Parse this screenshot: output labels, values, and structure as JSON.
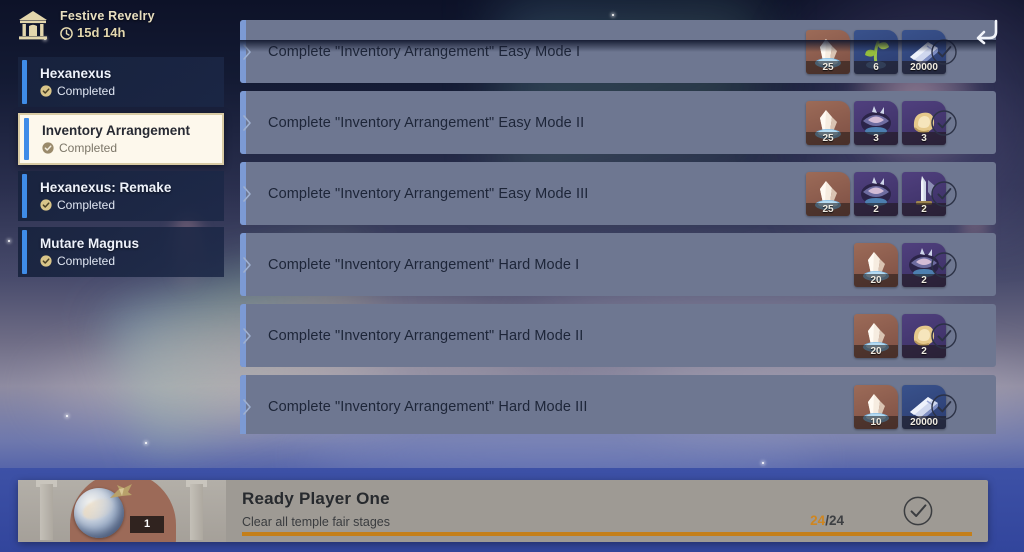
{
  "header": {
    "event_title": "Festive Revelry",
    "timer": "15d 14h",
    "temple_icon": "temple-icon",
    "clock_icon": "clock-icon",
    "back_icon": "back-arrow-icon"
  },
  "sidebar": {
    "items": [
      {
        "title": "Hexanexus",
        "status": "Completed",
        "selected": false
      },
      {
        "title": "Inventory Arrangement",
        "status": "Completed",
        "selected": true
      },
      {
        "title": "Hexanexus: Remake",
        "status": "Completed",
        "selected": false
      },
      {
        "title": "Mutare Magnus",
        "status": "Completed",
        "selected": false
      }
    ]
  },
  "tasks": [
    {
      "label": "Complete \"Inventory Arrangement\" Easy Mode I",
      "rewards": [
        {
          "count": "25",
          "tone": "rv-orange",
          "art": "crystal"
        },
        {
          "count": "6",
          "tone": "rv-blue",
          "art": "sprout"
        },
        {
          "count": "20000",
          "tone": "rv-blue",
          "art": "scroll"
        }
      ],
      "claimed": true
    },
    {
      "label": "Complete \"Inventory Arrangement\" Easy Mode II",
      "rewards": [
        {
          "count": "25",
          "tone": "rv-orange",
          "art": "crystal"
        },
        {
          "count": "3",
          "tone": "rv-purple",
          "art": "gem"
        },
        {
          "count": "3",
          "tone": "rv-purple",
          "art": "cloth"
        }
      ],
      "claimed": true
    },
    {
      "label": "Complete \"Inventory Arrangement\" Easy Mode III",
      "rewards": [
        {
          "count": "25",
          "tone": "rv-orange",
          "art": "crystal"
        },
        {
          "count": "2",
          "tone": "rv-purple",
          "art": "gem"
        },
        {
          "count": "2",
          "tone": "rv-purple",
          "art": "weapon"
        }
      ],
      "claimed": true
    },
    {
      "label": "Complete \"Inventory Arrangement\" Hard Mode I",
      "rewards": [
        {
          "count": "20",
          "tone": "rv-orange",
          "art": "crystal"
        },
        {
          "count": "2",
          "tone": "rv-purple",
          "art": "gem"
        }
      ],
      "claimed": true
    },
    {
      "label": "Complete \"Inventory Arrangement\" Hard Mode II",
      "rewards": [
        {
          "count": "20",
          "tone": "rv-orange",
          "art": "crystal"
        },
        {
          "count": "2",
          "tone": "rv-purple",
          "art": "cloth"
        }
      ],
      "claimed": true
    },
    {
      "label": "Complete \"Inventory Arrangement\" Hard Mode III",
      "rewards": [
        {
          "count": "10",
          "tone": "rv-orange",
          "art": "crystal"
        },
        {
          "count": "20000",
          "tone": "rv-blue",
          "art": "scroll"
        }
      ],
      "claimed": true
    }
  ],
  "bottom_banner": {
    "title": "Ready Player One",
    "subtitle": "Clear all temple fair stages",
    "reward_count": "1",
    "progress_current": "24",
    "progress_separator": "/",
    "progress_total": "24",
    "progress_percent": 100,
    "check_icon": "check-circle-icon"
  },
  "colors": {
    "accent_blue": "#3f8ce8",
    "row_background": "#6e7791",
    "selected_card": "#fdf8ec",
    "selected_border": "#d9cba4",
    "progress_orange": "#c47f1a",
    "band_blue": "#32459c",
    "header_gold": "#e8dfc0"
  }
}
